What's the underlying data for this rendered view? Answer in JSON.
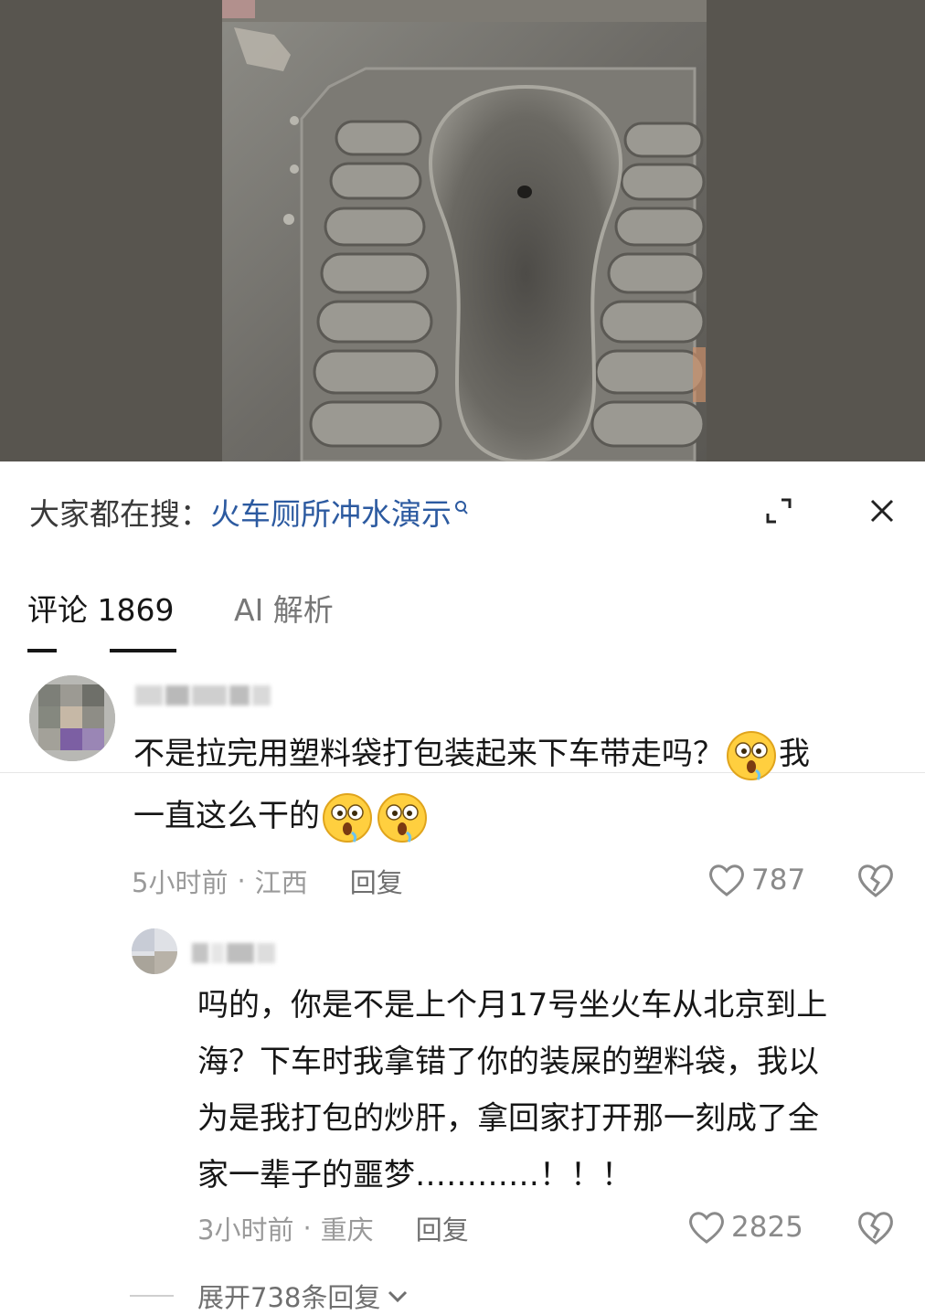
{
  "media": {
    "icon": "train-toilet-photo"
  },
  "search": {
    "prefix": "大家都在搜：",
    "query": "火车厕所冲水演示",
    "icon": "search-icon"
  },
  "header_actions": {
    "expand_icon": "expand-icon",
    "close_icon": "close-icon"
  },
  "tabs": [
    {
      "label": "评论 1869",
      "active": true
    },
    {
      "label": "AI 解析",
      "active": false
    }
  ],
  "comments": [
    {
      "text_line1": "不是拉完用塑料袋打包装起来下车带走吗？",
      "text_line1_tail": "我",
      "text_line2": "一直这么干的",
      "emoji": "shocked-face-emoji",
      "time": "5小时前",
      "location": "江西",
      "reply_label": "回复",
      "likes": "787"
    },
    {
      "text_lines": [
        "吗的，你是不是上个月17号坐火车从北京到上",
        "海？下车时我拿错了你的装屎的塑料袋，我以",
        "为是我打包的炒肝，拿回家打开那一刻成了全",
        "家一辈子的噩梦…………！！！"
      ],
      "time": "3小时前",
      "location": "重庆",
      "reply_label": "回复",
      "likes": "2825"
    }
  ],
  "expand_replies": {
    "label": "展开738条回复",
    "icon": "chevron-down-icon"
  },
  "colors": {
    "link": "#2c5aa0",
    "muted": "#9a9a9a",
    "text": "#161616"
  }
}
